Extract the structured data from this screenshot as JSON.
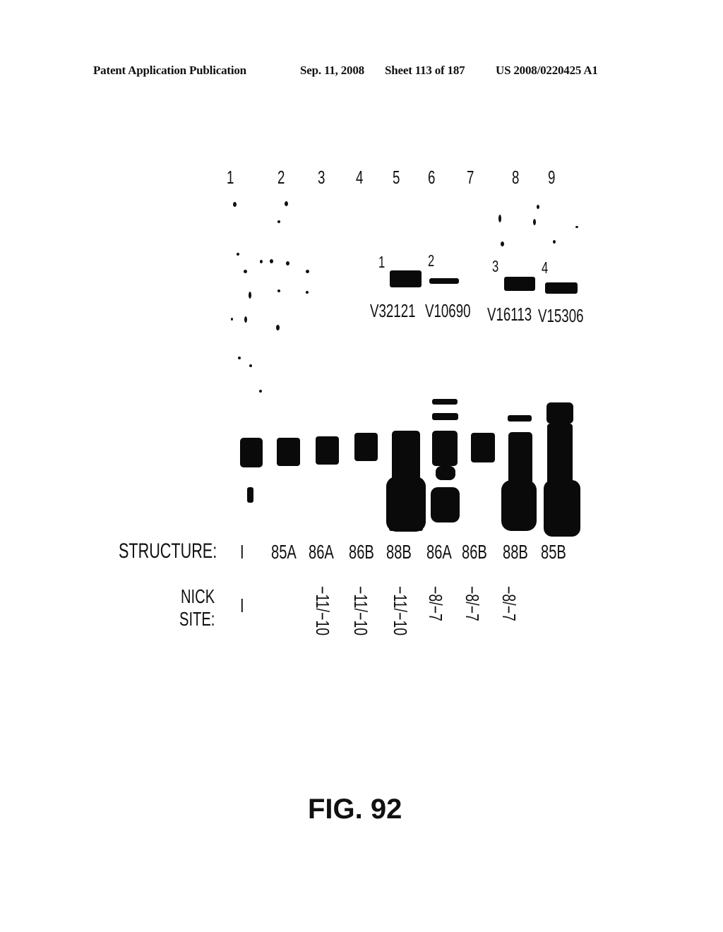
{
  "header": {
    "publication": "Patent Application Publication",
    "date": "Sep. 11, 2008",
    "sheet": "Sheet 113 of 187",
    "patent_number": "US 2008/0220425 A1"
  },
  "figure": {
    "lane_numbers": [
      "1",
      "2",
      "3",
      "4",
      "5",
      "6",
      "7",
      "8",
      "9"
    ],
    "blots": [
      {
        "number": "1",
        "label": "V32121"
      },
      {
        "number": "2",
        "label": "V10690"
      },
      {
        "number": "3",
        "label": "V16113"
      },
      {
        "number": "4",
        "label": "V15306"
      }
    ],
    "structure_label": "STRUCTURE:",
    "structures": [
      "I",
      "85A",
      "86A",
      "86B",
      "88B",
      "86A",
      "86B",
      "88B",
      "85B"
    ],
    "nick_label_line1": "NICK",
    "nick_label_line2": "SITE:",
    "nick_sites": [
      "I",
      "",
      "−11/−10",
      "−11/−10",
      "−11/−10",
      "−8/−7",
      "−8/−7",
      "−8/−7",
      ""
    ],
    "caption": "FIG. 92"
  }
}
